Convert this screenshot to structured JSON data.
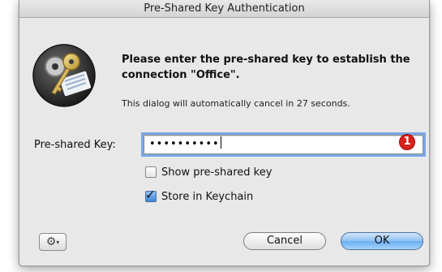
{
  "window": {
    "title": "Pre-Shared Key Authentication"
  },
  "message": {
    "heading": "Please enter the pre-shared key to establish the connection \"Office\".",
    "countdown": "This dialog will automatically cancel in 27 seconds."
  },
  "key_field": {
    "label": "Pre-shared Key:",
    "value": "••••••••••",
    "badge": "1"
  },
  "options": {
    "show_key": {
      "label": "Show pre-shared key",
      "checked": false
    },
    "store_keychain": {
      "label": "Store in Keychain",
      "checked": true
    }
  },
  "buttons": {
    "gear_icon": "gear-icon",
    "cancel": "Cancel",
    "ok": "OK"
  },
  "colors": {
    "focus_ring": "#7aa7e6",
    "badge": "#d8211c",
    "default_button": "#6aaef0"
  }
}
